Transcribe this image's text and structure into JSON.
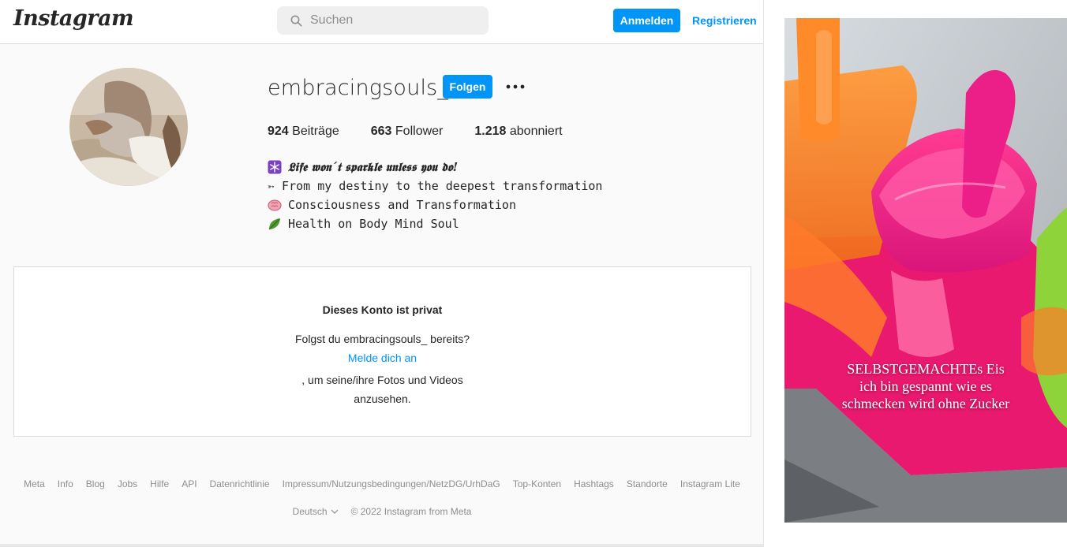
{
  "header": {
    "logo": "Instagram",
    "search_placeholder": "Suchen",
    "login_label": "Anmelden",
    "register_label": "Registrieren"
  },
  "profile": {
    "username": "embracingsouls_",
    "follow_label": "Folgen",
    "stats": {
      "posts_count": "924",
      "posts_label": "Beiträge",
      "followers_count": "663",
      "followers_label": "Follower",
      "following_count": "1.218",
      "following_label": "abonniert"
    },
    "bio": [
      {
        "icon": "snowflake-emoji",
        "text": "𝕷𝖎𝖋𝖊 𝖜𝖔𝖓´𝖙 𝖘𝖕𝖆𝖗𝖐𝖑𝖊 𝖚𝖓𝖑𝖊𝖘𝖘 𝖞𝖔𝖚 𝖉𝖔!"
      },
      {
        "icon": "arrow-emoji",
        "text": "➳ From my destiny to the deepest transformation"
      },
      {
        "icon": "brain-emoji",
        "text": "Consciousness and Transformation"
      },
      {
        "icon": "leaf-emoji",
        "text": "Health on Body Mind Soul"
      }
    ]
  },
  "private": {
    "title": "Dieses Konto ist privat",
    "question": "Folgst du embracingsouls_ bereits?",
    "link": "Melde dich an",
    "tail_line1": ", um seine/ihre Fotos und Videos",
    "tail_line2": "anzusehen."
  },
  "footer": {
    "links": [
      "Meta",
      "Info",
      "Blog",
      "Jobs",
      "Hilfe",
      "API",
      "Datenrichtlinie",
      "Impressum/Nutzungsbedingungen/NetzDG/UrhDaG",
      "Top-Konten",
      "Hashtags",
      "Standorte",
      "Instagram Lite"
    ],
    "language": "Deutsch",
    "copyright": "© 2022 Instagram from Meta"
  },
  "promo": {
    "caption_lines": [
      "SELBSTGEMACHTEs Eis",
      "ich bin gespannt wie es",
      "schmecken wird ohne Zucker"
    ]
  },
  "colors": {
    "accent": "#0095f6",
    "text": "#262626",
    "muted": "#8e8e8e",
    "border": "#dbdbdb"
  }
}
